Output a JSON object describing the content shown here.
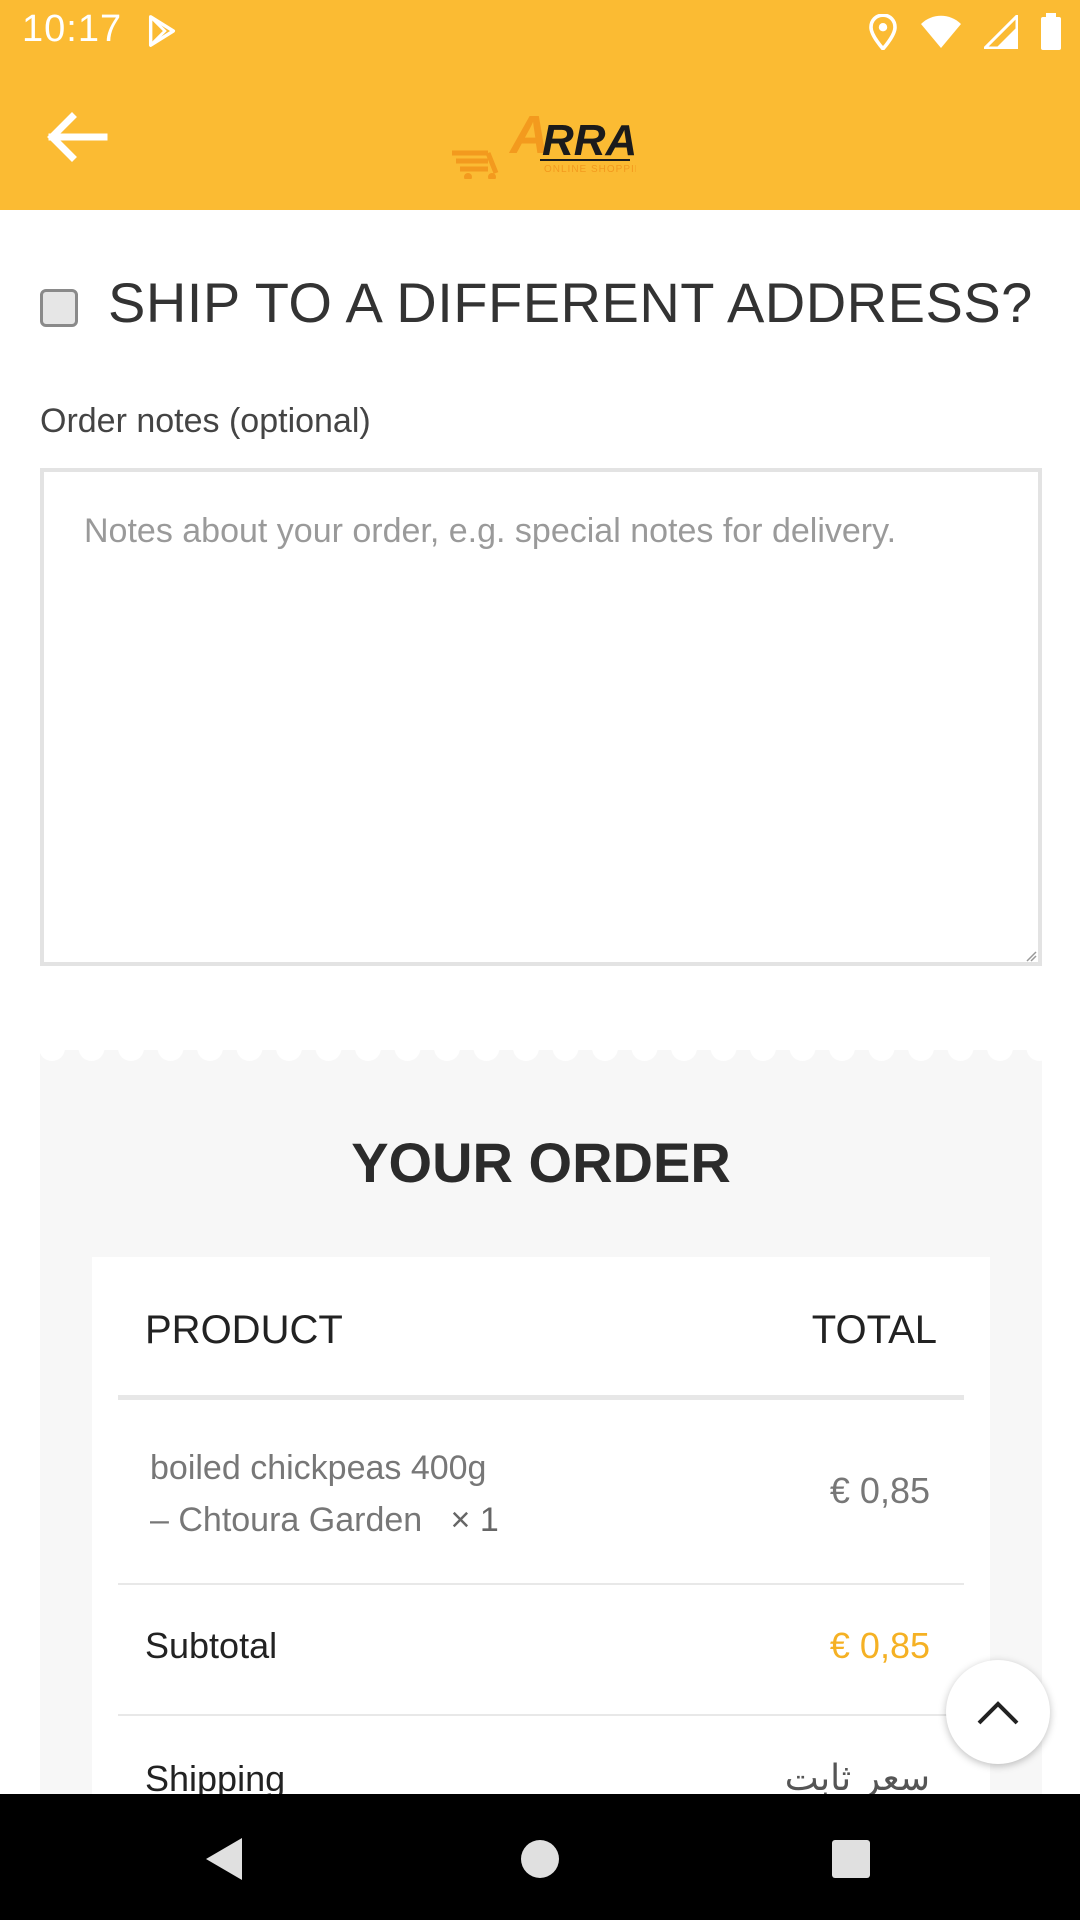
{
  "status_bar": {
    "time": "10:17",
    "icons": [
      "play-store-icon",
      "location-icon",
      "wifi-icon",
      "signal-icon",
      "battery-icon"
    ]
  },
  "app_bar": {
    "back_icon": "arrow-left-icon",
    "logo_text": "ARRAM",
    "logo_tagline": "ONLINE SHOPPING",
    "background_color": "#fbbb33"
  },
  "form": {
    "ship_different_label": "SHIP TO A DIFFERENT ADDRESS?",
    "ship_different_checked": false,
    "order_notes_label": "Order notes (optional)",
    "order_notes_placeholder": "Notes about your order, e.g. special notes for delivery.",
    "order_notes_value": ""
  },
  "order": {
    "title": "YOUR ORDER",
    "headers": {
      "product": "PRODUCT",
      "total": "TOTAL"
    },
    "items": [
      {
        "name_line1": "boiled chickpeas 400g",
        "name_line2": "– Chtoura Garden",
        "quantity": "× 1",
        "price": "€ 0,85"
      }
    ],
    "subtotal_label": "Subtotal",
    "subtotal_value": "€ 0,85",
    "shipping_label": "Shipping",
    "shipping_value": "سعر ثابت",
    "accent_color": "#f5b124"
  },
  "scroll_top_icon": "chevron-up-icon",
  "nav_bar": {
    "buttons": [
      "back-triangle-icon",
      "home-circle-icon",
      "recents-square-icon"
    ]
  }
}
